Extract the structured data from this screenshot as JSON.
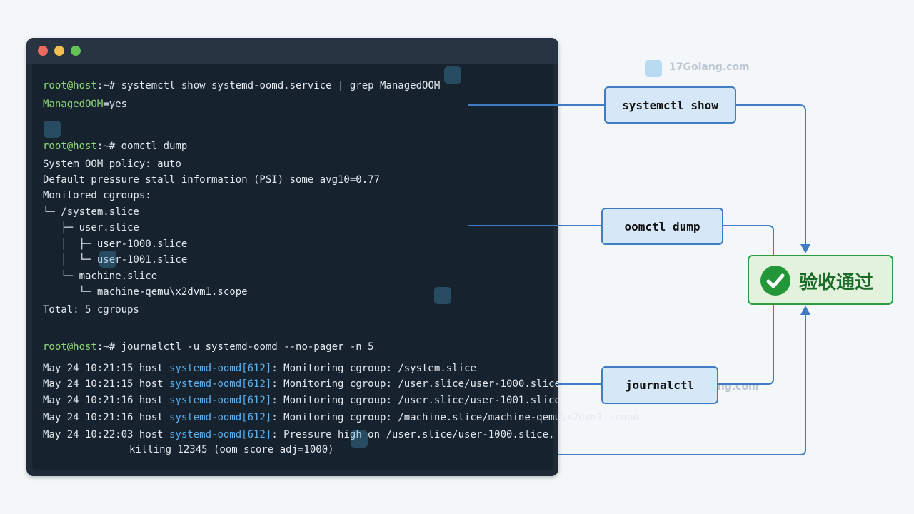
{
  "terminal": {
    "section1": {
      "prompt_user": "root@host",
      "prompt_path": ":~#",
      "command": " systemctl show systemd-oomd.service | grep ManagedOOM",
      "output_key": "ManagedOOM",
      "output_val": "=yes"
    },
    "section2": {
      "prompt_user": "root@host",
      "prompt_path": ":~#",
      "command": " oomctl dump",
      "lines": [
        "System OOM policy: auto",
        "Default pressure stall information (PSI) some avg10=0.77",
        "Monitored cgroups:",
        "└─ /system.slice",
        "   ├─ user.slice",
        "   │  ├─ user-1000.slice",
        "   │  └─ user-1001.slice",
        "   └─ machine.slice",
        "      └─ machine-qemu\\x2dvm1.scope",
        "Total: 5 cgroups"
      ]
    },
    "section3": {
      "prompt_user": "root@host",
      "prompt_path": ":~#",
      "command": " journalctl -u systemd-oomd --no-pager -n 5",
      "logs": [
        {
          "prefix": "May 24 10:21:15 host ",
          "unit": "systemd-oomd[612]",
          "msg": ": Monitoring cgroup: /system.slice"
        },
        {
          "prefix": "May 24 10:21:15 host ",
          "unit": "systemd-oomd[612]",
          "msg": ": Monitoring cgroup: /user.slice/user-1000.slice"
        },
        {
          "prefix": "May 24 10:21:16 host ",
          "unit": "systemd-oomd[612]",
          "msg": ": Monitoring cgroup: /user.slice/user-1001.slice"
        },
        {
          "prefix": "May 24 10:21:16 host ",
          "unit": "systemd-oomd[612]",
          "msg": ": Monitoring cgroup: /machine.slice/machine-qemu\\x2dvm1.scope"
        },
        {
          "prefix": "May 24 10:22:03 host ",
          "unit": "systemd-oomd[612]",
          "msg": ": Pressure high on /user.slice/user-1000.slice,"
        }
      ],
      "continuation": "killing 12345 (oom_score_adj=1000)"
    }
  },
  "labels": {
    "systemctl": "systemctl show",
    "oomctl": "oomctl dump",
    "journalctl": "journalctl"
  },
  "result": {
    "text": "验收通过",
    "icon": "check-circle-icon"
  },
  "watermark": {
    "text": "17Golang.com"
  },
  "colors": {
    "prompt": "#8fd67a",
    "unit": "#5db0ee",
    "connector": "#3f7cc4",
    "success": "#2f9a3f"
  }
}
